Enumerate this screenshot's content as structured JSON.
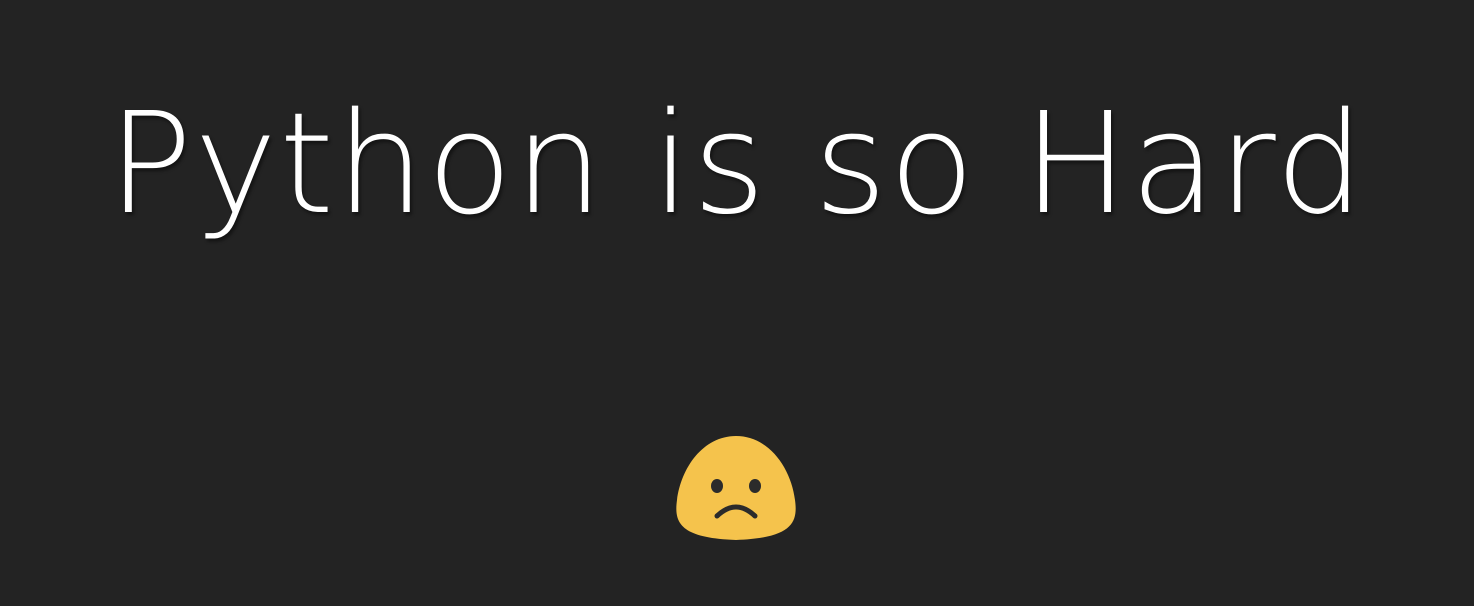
{
  "headline": {
    "text": "Python is so Hard",
    "color": "#ffffff"
  },
  "emoji": {
    "icon": "slightly-frowning-face-icon",
    "face_color": "#f5c34c",
    "feature_color": "#2b2b2b"
  },
  "background_color": "#232323"
}
